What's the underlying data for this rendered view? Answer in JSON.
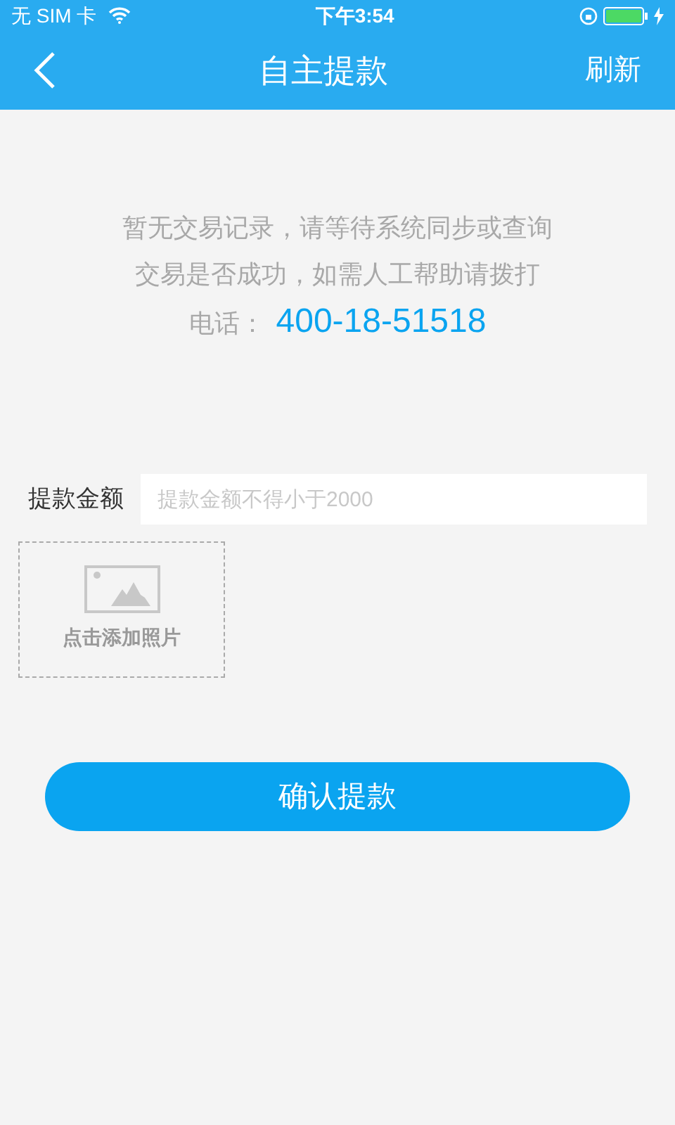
{
  "status_bar": {
    "carrier": "无 SIM 卡",
    "time": "下午3:54"
  },
  "nav": {
    "title": "自主提款",
    "action": "刷新"
  },
  "notice": {
    "lines": [
      "暂无交易记录，请等待系统同步或查询",
      "交易是否成功，如需人工帮助请拨打"
    ],
    "phone_label": "电话：",
    "phone_number": "400-18-51518"
  },
  "amount_field": {
    "label": "提款金额",
    "placeholder": "提款金额不得小于2000"
  },
  "photo_upload": {
    "label": "点击添加照片"
  },
  "submit_button": "确认提款"
}
